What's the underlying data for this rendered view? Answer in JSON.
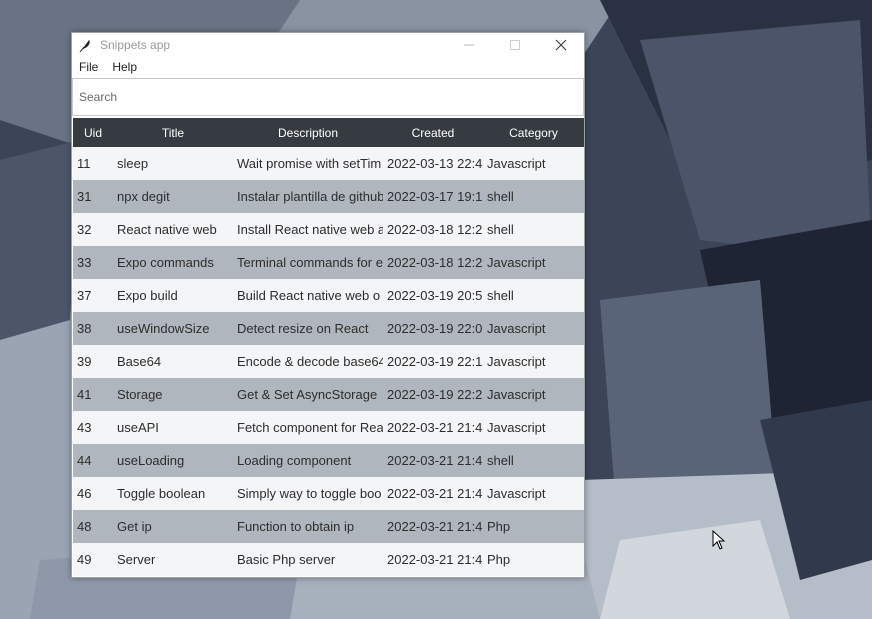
{
  "window": {
    "title": "Snippets app"
  },
  "menu": [
    "File",
    "Help"
  ],
  "search": {
    "placeholder": "Search",
    "value": ""
  },
  "table": {
    "headers": [
      "Uid",
      "Title",
      "Description",
      "Created",
      "Category"
    ],
    "rows": [
      [
        "11",
        "sleep",
        "Wait promise with setTim",
        "2022-03-13 22:4",
        "Javascript"
      ],
      [
        "31",
        "npx degit",
        "Instalar plantilla de github",
        "2022-03-17 19:1",
        "shell"
      ],
      [
        "32",
        "React native web",
        "Install React native web a",
        "2022-03-18 12:2",
        "shell"
      ],
      [
        "33",
        "Expo commands",
        "Terminal commands for e",
        "2022-03-18 12:2",
        "Javascript"
      ],
      [
        "37",
        "Expo build",
        "Build  React native web o",
        "2022-03-19 20:5",
        "shell"
      ],
      [
        "38",
        "useWindowSize",
        "Detect resize on React",
        "2022-03-19 22:0",
        "Javascript"
      ],
      [
        "39",
        "Base64",
        "Encode & decode base64",
        "2022-03-19 22:1",
        "Javascript"
      ],
      [
        "41",
        "Storage",
        "Get & Set AsyncStorage",
        "2022-03-19 22:2",
        "Javascript"
      ],
      [
        "43",
        "useAPI",
        "Fetch component for Rea",
        "2022-03-21 21:4",
        "Javascript"
      ],
      [
        "44",
        "useLoading",
        "Loading component",
        "2022-03-21 21:4",
        "shell"
      ],
      [
        "46",
        "Toggle boolean",
        "Simply way to toggle boo",
        "2022-03-21 21:4",
        "Javascript"
      ],
      [
        "48",
        "Get ip",
        "Function to obtain ip",
        "2022-03-21 21:4",
        "Php"
      ],
      [
        "49",
        "Server",
        "Basic Php server",
        "2022-03-21 21:4",
        "Php"
      ]
    ]
  },
  "colors": {
    "header_bg": "#353b41",
    "row_light": "#f4f5f7",
    "row_dark": "#b0b6bd",
    "desktop": "#3c4558"
  },
  "icons": {
    "app": "feather-icon",
    "minimize": "minimize-icon",
    "maximize": "maximize-icon",
    "close": "close-icon",
    "cursor": "mouse-cursor-icon"
  }
}
